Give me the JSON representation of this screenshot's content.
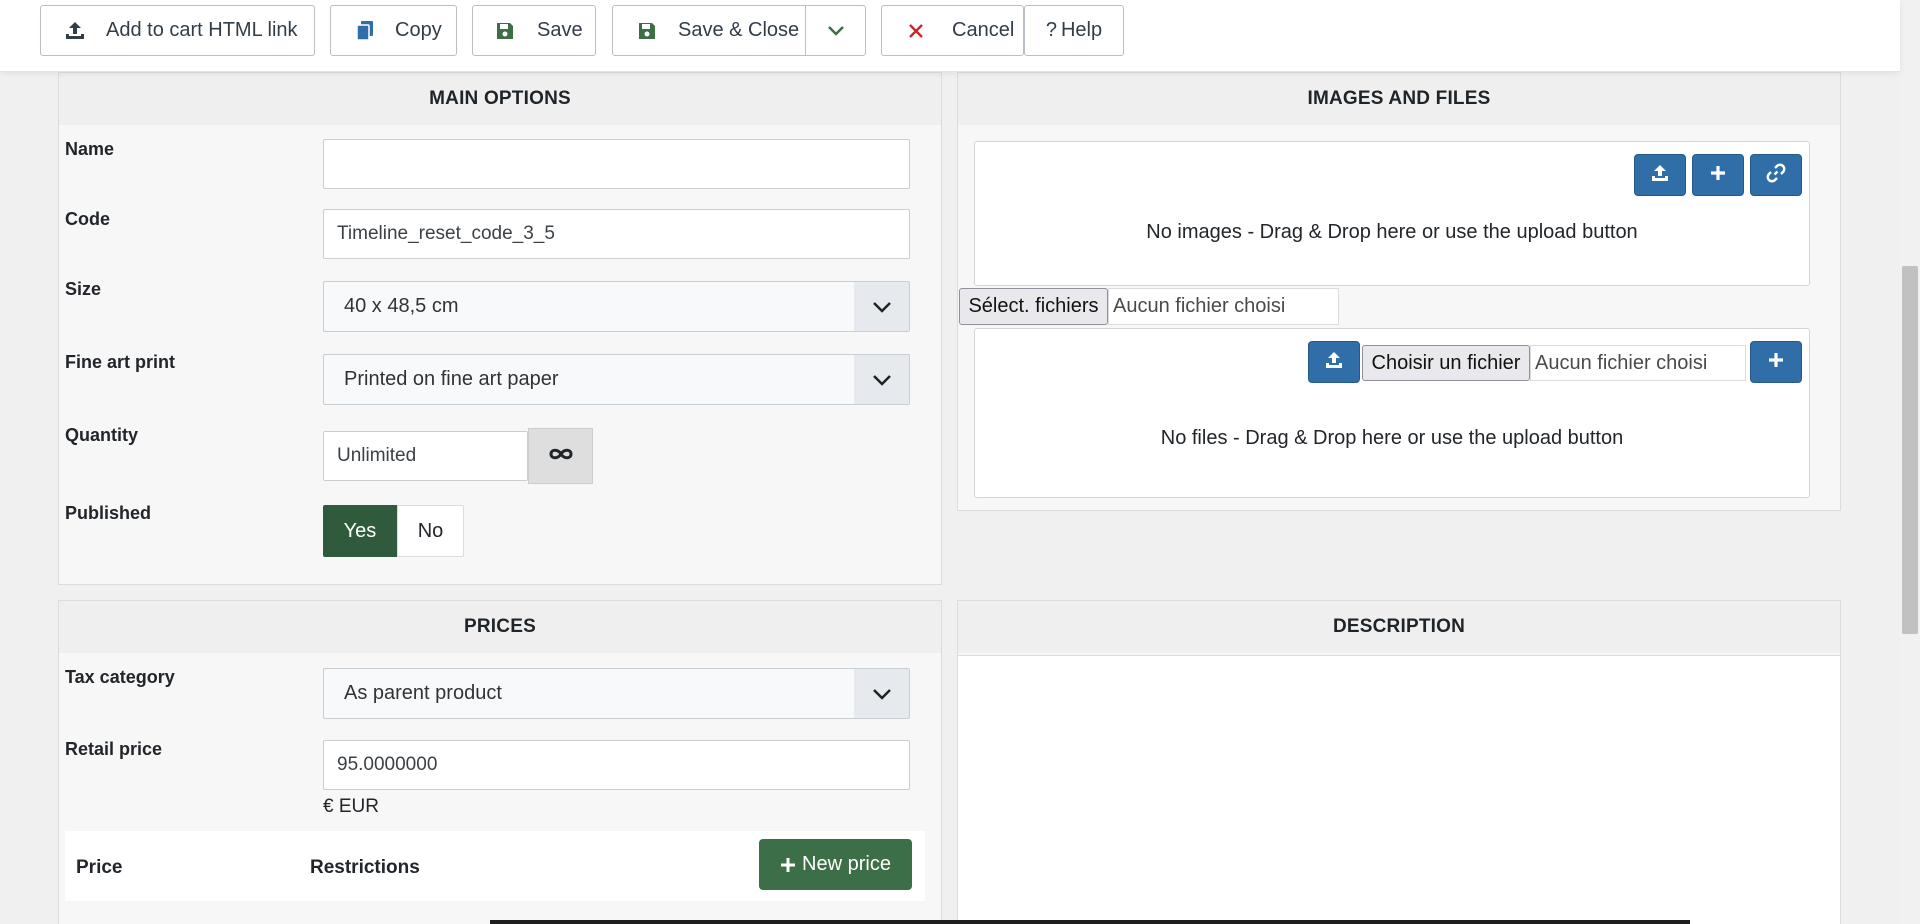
{
  "toolbar": {
    "add_to_cart": "Add to cart HTML link",
    "copy": "Copy",
    "save": "Save",
    "save_close": "Save & Close",
    "cancel": "Cancel",
    "help": "Help",
    "help_mark": "?"
  },
  "main_options": {
    "title": "MAIN OPTIONS",
    "name_label": "Name",
    "name_value": "",
    "code_label": "Code",
    "code_value": "Timeline_reset_code_3_5",
    "size_label": "Size",
    "size_value": "40 x 48,5 cm",
    "fineart_label": "Fine art print",
    "fineart_value": "Printed on fine art paper",
    "quantity_label": "Quantity",
    "quantity_value": "Unlimited",
    "published_label": "Published",
    "published_yes": "Yes",
    "published_no": "No",
    "published_selected": "Yes"
  },
  "images": {
    "title": "IMAGES AND FILES",
    "no_images": "No images - Drag & Drop here or use the upload button",
    "select_files": "Sélect. fichiers",
    "no_file_chosen_1": "Aucun fichier choisi",
    "choose_file": "Choisir un fichier",
    "no_file_chosen_2": "Aucun fichier choisi",
    "no_files": "No files - Drag & Drop here or use the upload button"
  },
  "prices": {
    "title": "PRICES",
    "tax_label": "Tax category",
    "tax_value": "As parent product",
    "retail_label": "Retail price",
    "retail_value": "95.0000000",
    "currency": "€ EUR",
    "col_price": "Price",
    "col_restrictions": "Restrictions",
    "new_price": "New price"
  },
  "description": {
    "title": "DESCRIPTION"
  },
  "colors": {
    "blue": "#2f6ea7",
    "green": "#3c6e47",
    "cancel_red": "#c52827"
  }
}
